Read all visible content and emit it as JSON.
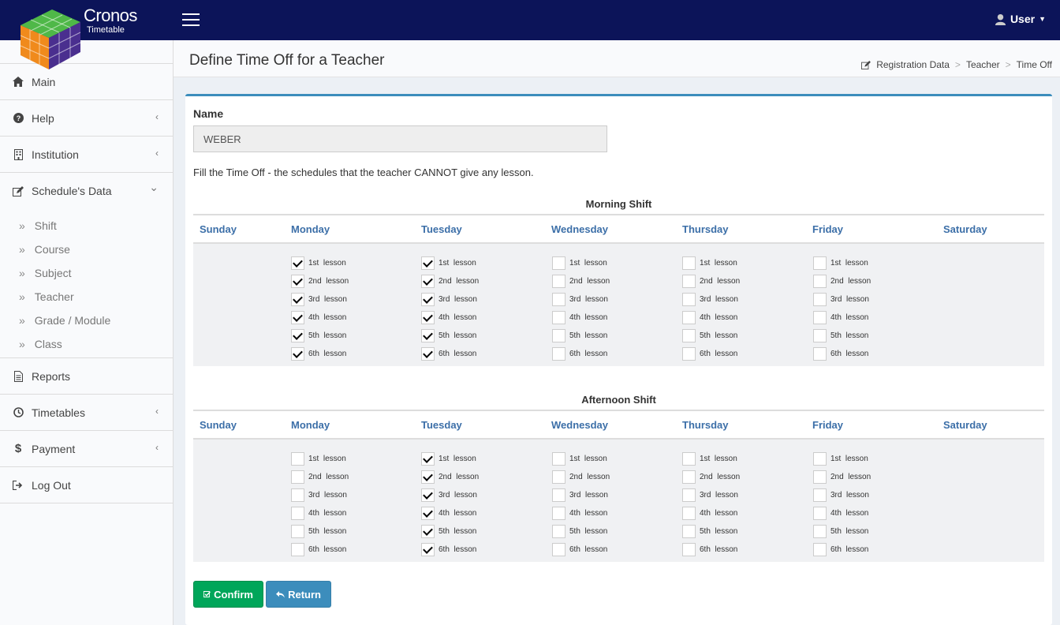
{
  "app": {
    "name": "Cronos",
    "subtitle": "Timetable"
  },
  "topbar": {
    "user_label": "User"
  },
  "sidebar": {
    "items": [
      {
        "label": "Main",
        "icon": "home-icon",
        "chevron": ""
      },
      {
        "label": "Help",
        "icon": "question-circle-icon",
        "chevron": "‹"
      },
      {
        "label": "Institution",
        "icon": "building-icon",
        "chevron": "‹"
      },
      {
        "label": "Schedule's Data",
        "icon": "edit-icon",
        "chevron": "⌄"
      }
    ],
    "sub_items": [
      "Shift",
      "Course",
      "Subject",
      "Teacher",
      "Grade / Module",
      "Class"
    ],
    "items_after": [
      {
        "label": "Reports",
        "icon": "file-icon",
        "chevron": ""
      },
      {
        "label": "Timetables",
        "icon": "clock-icon",
        "chevron": "‹"
      },
      {
        "label": "Payment",
        "icon": "dollar-icon",
        "chevron": "‹"
      },
      {
        "label": "Log Out",
        "icon": "sign-out-icon",
        "chevron": ""
      }
    ]
  },
  "header": {
    "title": "Define Time Off for a Teacher",
    "breadcrumb": [
      "Registration Data",
      "Teacher",
      "Time Off"
    ]
  },
  "form": {
    "name_label": "Name",
    "name_value": "WEBER",
    "instructions": "Fill the Time Off - the schedules that the teacher CANNOT give any lesson."
  },
  "days": [
    "Sunday",
    "Monday",
    "Tuesday",
    "Wednesday",
    "Thursday",
    "Friday",
    "Saturday"
  ],
  "lesson_labels": [
    "1st  lesson",
    "2nd  lesson",
    "3rd  lesson",
    "4th  lesson",
    "5th  lesson",
    "6th  lesson"
  ],
  "shifts": [
    {
      "title": "Morning Shift",
      "checked": {
        "Monday": [
          true,
          true,
          true,
          true,
          true,
          true
        ],
        "Tuesday": [
          true,
          true,
          true,
          true,
          true,
          true
        ],
        "Wednesday": [
          false,
          false,
          false,
          false,
          false,
          false
        ],
        "Thursday": [
          false,
          false,
          false,
          false,
          false,
          false
        ],
        "Friday": [
          false,
          false,
          false,
          false,
          false,
          false
        ]
      }
    },
    {
      "title": "Afternoon Shift",
      "checked": {
        "Monday": [
          false,
          false,
          false,
          false,
          false,
          false
        ],
        "Tuesday": [
          true,
          true,
          true,
          true,
          true,
          true
        ],
        "Wednesday": [
          false,
          false,
          false,
          false,
          false,
          false
        ],
        "Thursday": [
          false,
          false,
          false,
          false,
          false,
          false
        ],
        "Friday": [
          false,
          false,
          false,
          false,
          false,
          false
        ]
      }
    }
  ],
  "buttons": {
    "confirm": "Confirm",
    "return": "Return"
  },
  "colors": {
    "topbar": "#0c1459",
    "accent": "#3c8dbc",
    "confirm": "#00a65a",
    "day_header": "#3c6fa8"
  }
}
